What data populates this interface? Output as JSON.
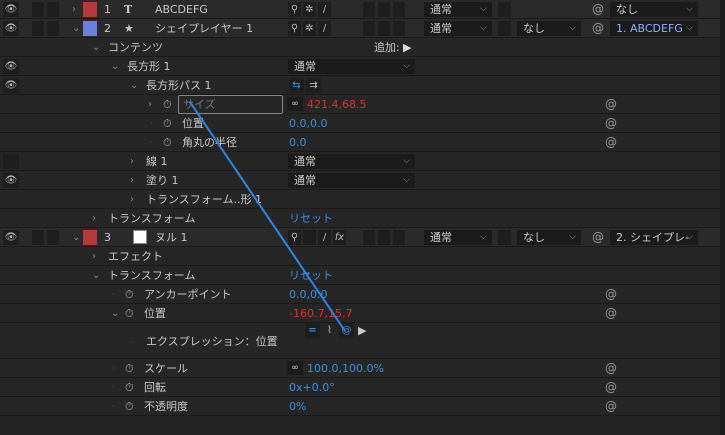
{
  "layers": [
    {
      "index": "1",
      "type_icon": "T",
      "name": "ABCDEFG",
      "color": "#b33a3a",
      "mode": "通常",
      "parent": "なし"
    },
    {
      "index": "2",
      "type_icon": "★",
      "name": "シェイプレイヤー 1",
      "color": "#6b7fe0",
      "mode": "通常",
      "trkmat": "なし",
      "parent": "1. ABCDEFG"
    },
    {
      "index": "3",
      "type_icon": "",
      "name": "ヌル 1",
      "color": "#b33a3a",
      "mode": "通常",
      "trkmat": "なし",
      "parent": "2. シェイプレ-"
    }
  ],
  "contents": {
    "label": "コンテンツ",
    "add": "追加:"
  },
  "rect": {
    "label": "長方形 1",
    "mode": "通常"
  },
  "rect_path": {
    "label": "長方形パス 1"
  },
  "size": {
    "label": "サイズ",
    "value": "421.4,68.5"
  },
  "rect_pos": {
    "label": "位置",
    "value": "0.0,0.0"
  },
  "roundness": {
    "label": "角丸の半径",
    "value": "0.0"
  },
  "stroke": {
    "label": "線 1",
    "mode": "通常"
  },
  "fill": {
    "label": "塗り 1",
    "mode": "通常"
  },
  "transform_rect": {
    "label": "トランスフォーム..形 1"
  },
  "transform2": {
    "label": "トランスフォーム",
    "reset": "リセット"
  },
  "effects": {
    "label": "エフェクト"
  },
  "transform3": {
    "label": "トランスフォーム",
    "reset": "リセット"
  },
  "anchor": {
    "label": "アンカーポイント",
    "value": "0.0,0.0"
  },
  "position": {
    "label": "位置",
    "value": "-160.7,15.7"
  },
  "expression": {
    "label": "エクスプレッション：位置"
  },
  "scale": {
    "label": "スケール",
    "value": "100.0,100.0%"
  },
  "rotation": {
    "label": "回転",
    "value": "0x+0.0°"
  },
  "opacity": {
    "label": "不透明度",
    "value": "0%"
  },
  "colors": {
    "accent": "#3d8fe0",
    "keyed": "#e03030"
  }
}
